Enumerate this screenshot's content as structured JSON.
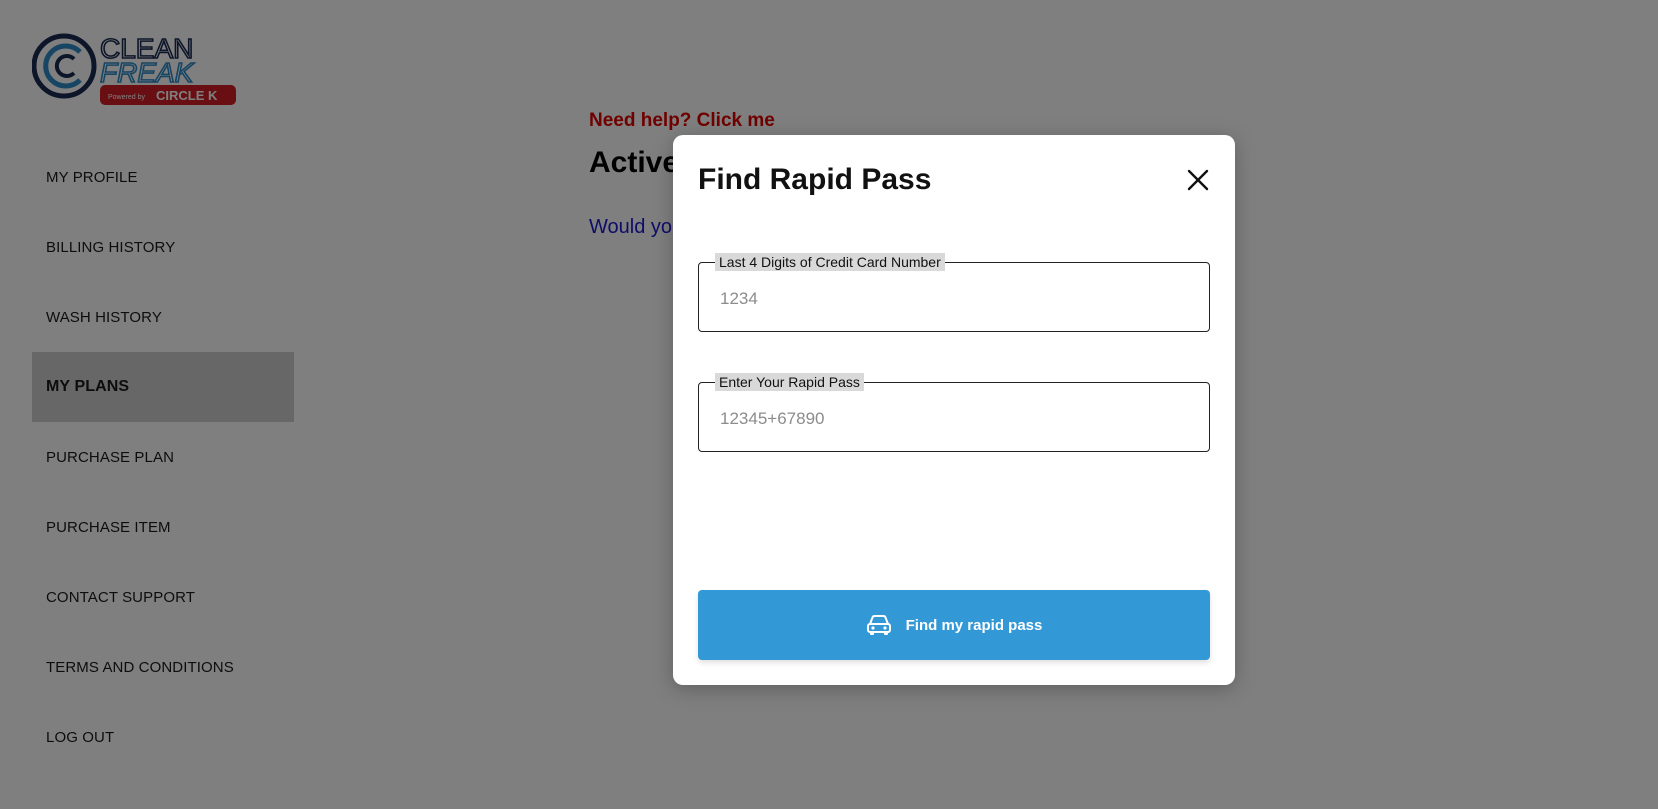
{
  "brand": {
    "name_line1": "CLEAN",
    "name_line2": "FREAK",
    "powered_by": "Powered by",
    "partner": "CIRCLE K",
    "colors": {
      "navy": "#1b2a52",
      "blue": "#2e8bc8",
      "red": "#d31f26"
    }
  },
  "sidebar": {
    "items": [
      {
        "label": "MY PROFILE",
        "active": false
      },
      {
        "label": "BILLING HISTORY",
        "active": false
      },
      {
        "label": "WASH HISTORY",
        "active": false
      },
      {
        "label": "MY PLANS",
        "active": true
      },
      {
        "label": "PURCHASE PLAN",
        "active": false
      },
      {
        "label": "PURCHASE ITEM",
        "active": false
      },
      {
        "label": "CONTACT SUPPORT",
        "active": false
      },
      {
        "label": "TERMS AND CONDITIONS",
        "active": false
      },
      {
        "label": "LOG OUT",
        "active": false
      }
    ]
  },
  "main": {
    "help_link": "Need help? Click me",
    "heading": "Active",
    "upsell": "Would yo"
  },
  "modal": {
    "title": "Find Rapid Pass",
    "close_icon": "close-icon",
    "fields": [
      {
        "label": "Last 4 Digits of Credit Card Number",
        "placeholder": "1234",
        "value": ""
      },
      {
        "label": "Enter Your Rapid Pass",
        "placeholder": "12345+67890",
        "value": ""
      }
    ],
    "submit": {
      "label": "Find my rapid pass",
      "icon": "car-icon",
      "color": "#3399d6"
    }
  }
}
